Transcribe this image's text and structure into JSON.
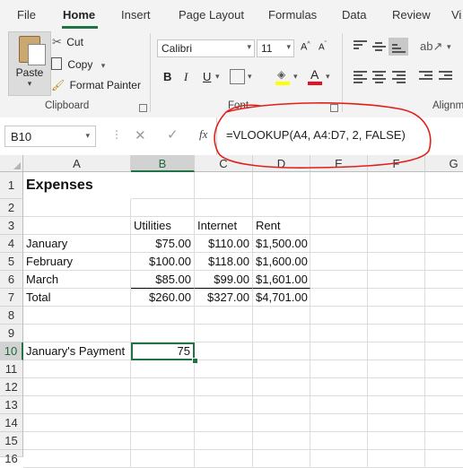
{
  "ribbon": {
    "tabs": [
      "File",
      "Home",
      "Insert",
      "Page Layout",
      "Formulas",
      "Data",
      "Review",
      "Vi"
    ],
    "active_tab": "Home",
    "clipboard": {
      "paste": "Paste",
      "cut": "Cut",
      "copy": "Copy",
      "format_painter": "Format Painter",
      "label": "Clipboard"
    },
    "font": {
      "name": "Calibri",
      "size": "11",
      "bold": "B",
      "italic": "I",
      "underline": "U",
      "label": "Font",
      "font_color": "#e81123",
      "fill_color": "#ffff00"
    },
    "alignment": {
      "label": "Alignm"
    }
  },
  "formula_bar": {
    "name_box": "B10",
    "fx": "fx",
    "formula": "=VLOOKUP(A4, A4:D7, 2, FALSE)",
    "annotation_color": "#e0201b"
  },
  "sheet": {
    "columns": [
      "A",
      "B",
      "C",
      "D",
      "E",
      "F",
      "G"
    ],
    "selected_column": "B",
    "rows": [
      "1",
      "2",
      "3",
      "4",
      "5",
      "6",
      "7",
      "8",
      "9",
      "10",
      "11",
      "12",
      "13",
      "14",
      "15",
      "16"
    ],
    "selected_row": "10",
    "selected_cell": "B10",
    "cells": {
      "A1": "Expenses",
      "B3": "Utilities",
      "C3": "Internet",
      "D3": "Rent",
      "A4": "January",
      "B4": "$75.00",
      "C4": "$110.00",
      "D4": "$1,500.00",
      "A5": "February",
      "B5": "$100.00",
      "C5": "$118.00",
      "D5": "$1,600.00",
      "A6": "March",
      "B6": "$85.00",
      "C6": "$99.00",
      "D6": "$1,601.00",
      "A7": "Total",
      "B7": "$260.00",
      "C7": "$327.00",
      "D7": "$4,701.00",
      "A10": "January's Payment",
      "B10": "75"
    },
    "accent_color": "#217346"
  }
}
